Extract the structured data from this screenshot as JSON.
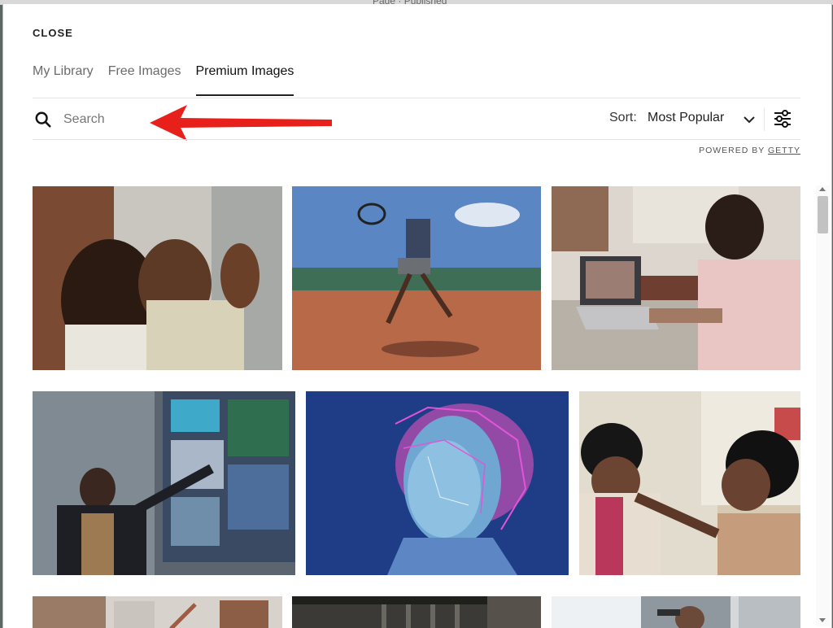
{
  "modal": {
    "close_label": "CLOSE",
    "tabs": [
      {
        "label": "My Library",
        "active": false
      },
      {
        "label": "Free Images",
        "active": false
      },
      {
        "label": "Premium Images",
        "active": true
      }
    ],
    "search": {
      "placeholder": "Search",
      "value": "",
      "icon": "search-icon"
    },
    "sort": {
      "label": "Sort:",
      "value": "Most Popular",
      "icon": "chevron-down-icon"
    },
    "filter_icon": "sliders-icon",
    "powered_by": {
      "prefix": "POWERED BY",
      "link": "GETTY"
    },
    "annotation": {
      "icon": "red-arrow-icon",
      "color": "#e8201c"
    },
    "images": [
      {
        "name": "couple-dancing-image"
      },
      {
        "name": "tennis-player-image"
      },
      {
        "name": "man-video-call-image"
      },
      {
        "name": "woman-touchscreen-image"
      },
      {
        "name": "wireframe-statue-image"
      },
      {
        "name": "women-laughing-image"
      },
      {
        "name": "office-image"
      },
      {
        "name": "interior-image"
      },
      {
        "name": "car-driver-image"
      }
    ]
  },
  "background": {
    "title_fragment": "Page · Published"
  }
}
